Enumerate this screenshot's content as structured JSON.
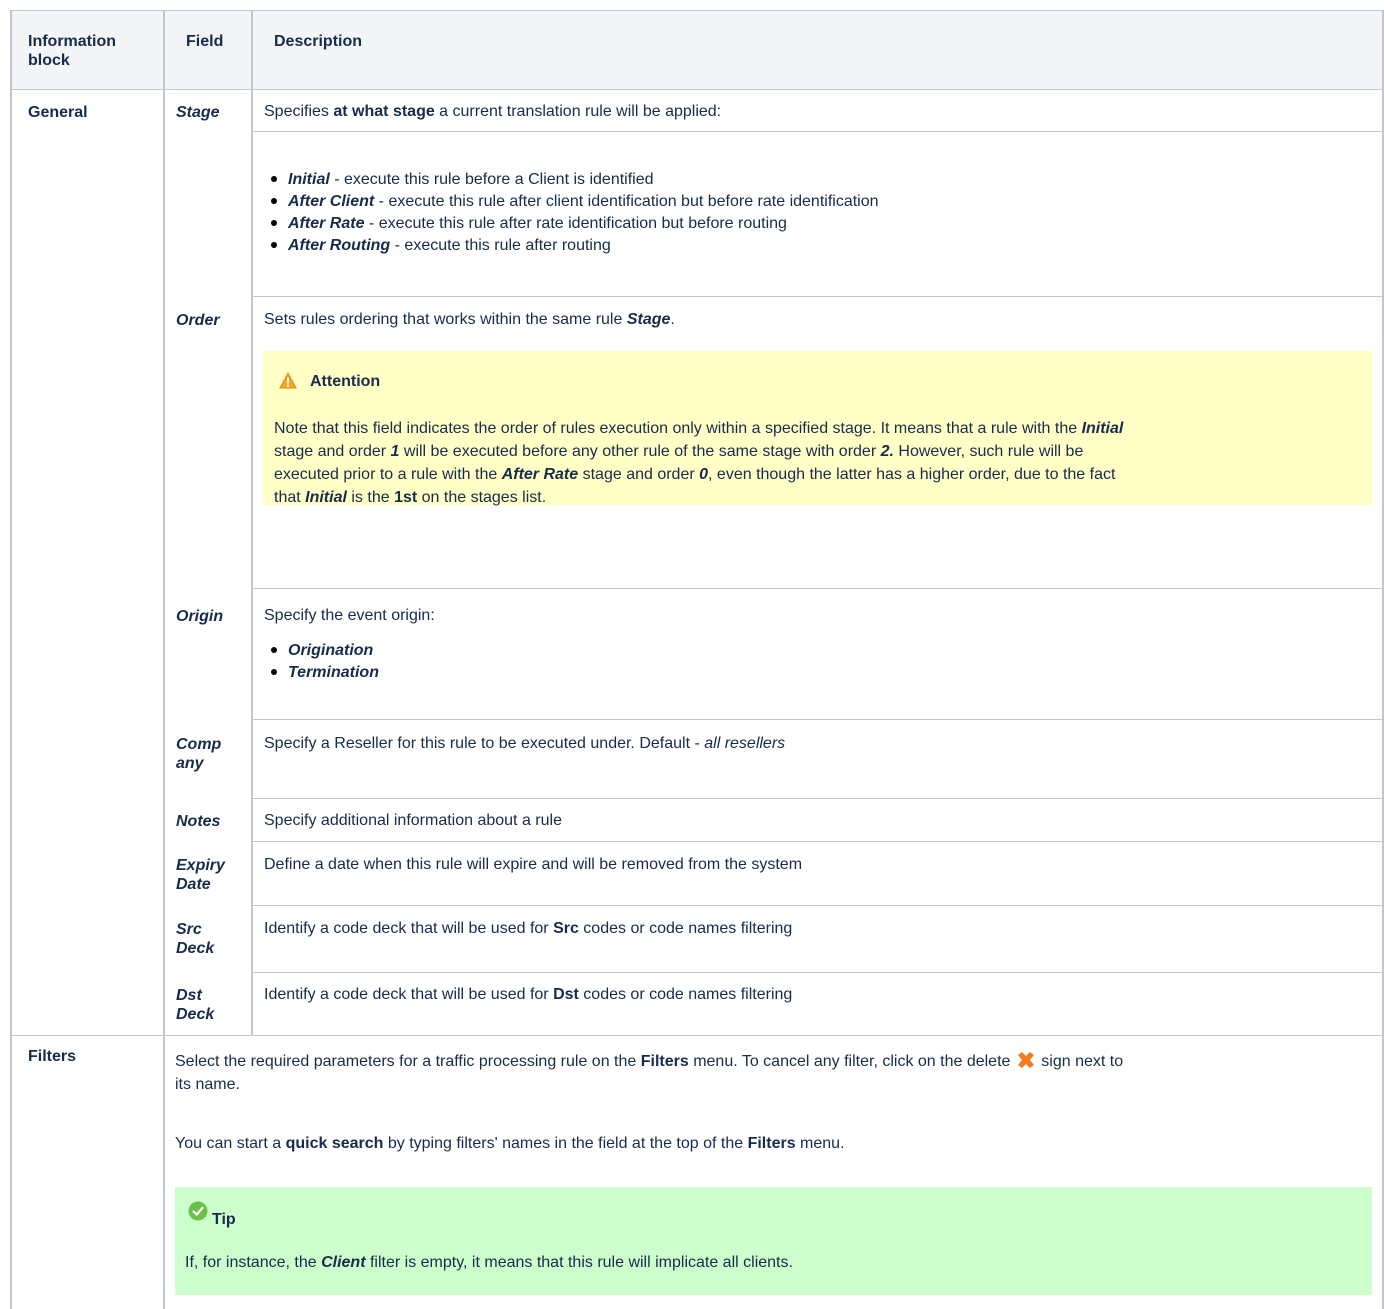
{
  "header": {
    "col1": "Information block",
    "col2": "Field",
    "col3": "Description"
  },
  "general": {
    "block": "General",
    "stage": {
      "field": "Stage",
      "desc_pre": "Specifies ",
      "desc_bold": "at what stage",
      "desc_post": " a current translation rule will be applied:",
      "items": [
        {
          "term": "Initial",
          "text": " - execute this rule before a Client is identified"
        },
        {
          "term": "After Client",
          "text": " - execute this rule after client identification but before rate identification"
        },
        {
          "term": "After Rate",
          "text": " - execute this rule after rate identification but before routing"
        },
        {
          "term": "After Routing",
          "text": " - execute this rule after routing"
        }
      ]
    },
    "order": {
      "field": "Order",
      "desc_pre": "Sets rules ordering that works within the same rule ",
      "desc_bi": "Stage",
      "desc_post": ".",
      "attention": {
        "title": "Attention",
        "l1_a": "Note that this field indicates the order of rules execution only within a specified stage. It means that a rule with the ",
        "l1_b": "Initial",
        "l2_a": "stage and order ",
        "l2_b": "1",
        "l2_c": " will be executed before any other rule of the same stage with order  ",
        "l2_d": "2.",
        "l2_e": " However, such rule will be",
        "l3_a": "executed prior to a rule with the ",
        "l3_b": "After Rate",
        "l3_c": " stage and order ",
        "l3_d": "0",
        "l3_e": ", even though the latter has a higher order, due to the fact",
        "l4_a": "that ",
        "l4_b": "Initial",
        "l4_c": " is the ",
        "l4_d": "1st",
        "l4_e": " on the stages list."
      }
    },
    "origin": {
      "field": "Origin",
      "desc": "Specify the event origin:",
      "items": [
        "Origination",
        "Termination"
      ]
    },
    "company": {
      "field_l1": "Comp",
      "field_l2": "any",
      "desc_pre": "Specify a Reseller for this rule to be executed under. Default - ",
      "desc_it": "all resellers"
    },
    "notes": {
      "field": "Notes",
      "desc": "Specify additional information about a rule"
    },
    "expiry": {
      "field_l1": "Expiry",
      "field_l2": "Date",
      "desc": "Define a date when this rule will expire and will be removed from the system"
    },
    "src": {
      "field_l1": "Src",
      "field_l2": "Deck",
      "desc_pre": "Identify a code deck that will be used for ",
      "desc_bold": "Src",
      "desc_post": " codes or code names filtering"
    },
    "dst": {
      "field_l1": "Dst",
      "field_l2": "Deck",
      "desc_pre": "Identify a code deck that will be used for ",
      "desc_bold": "Dst",
      "desc_post": " codes or code names filtering"
    }
  },
  "filters": {
    "block": "Filters",
    "p1_a": "Select the required parameters for a traffic processing rule on the ",
    "p1_b": "Filters",
    "p1_c": " menu. To cancel any filter, click on the delete ",
    "p1_d": " sign next to",
    "p1_e": "its name.",
    "p2_a": "You can start a ",
    "p2_b": "quick search",
    "p2_c": " by typing filters' names in the field at the top of the ",
    "p2_d": "Filters",
    "p2_e": " menu.",
    "tip": {
      "title": "Tip",
      "a": "If, for instance, the ",
      "b": "Client",
      "c": " filter is empty, it means that this rule will implicate all clients."
    }
  },
  "icons": {
    "warning": "warning-triangle-icon",
    "check": "check-circle-icon",
    "delete": "delete-x-icon"
  },
  "colors": {
    "attention_bg": "#ffffc6",
    "tip_bg": "#ccffcc",
    "header_bg": "#f4f5f7",
    "border": "#c1c7d0",
    "delete_icon": "#f47b20",
    "check_icon": "#5cb85c"
  }
}
